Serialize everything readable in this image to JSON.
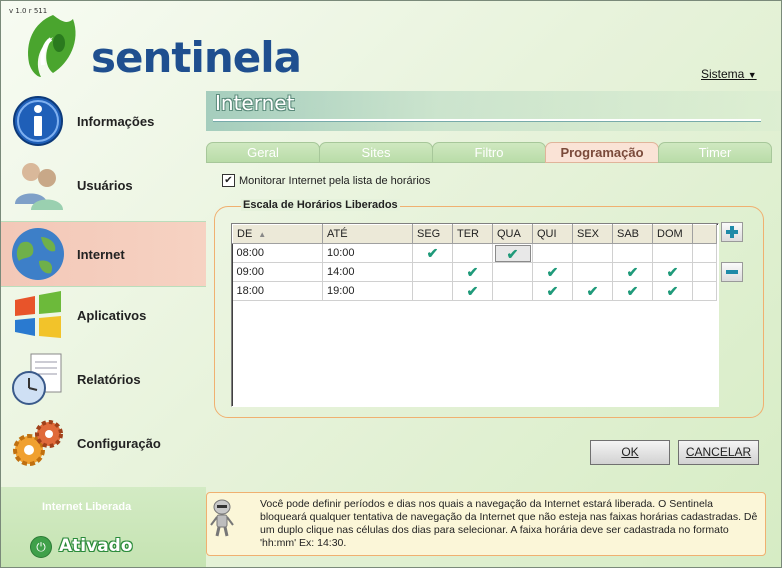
{
  "app": {
    "version": "v 1.0 r 511",
    "logo_text": "sentinela",
    "system_menu": "Sistema"
  },
  "sidebar": {
    "items": [
      {
        "label": "Informações",
        "icon": "info-icon"
      },
      {
        "label": "Usuários",
        "icon": "users-icon"
      },
      {
        "label": "Internet",
        "icon": "globe-icon",
        "active": true
      },
      {
        "label": "Aplicativos",
        "icon": "windows-icon"
      },
      {
        "label": "Relatórios",
        "icon": "report-clock-icon"
      },
      {
        "label": "Configuração",
        "icon": "gears-icon"
      }
    ],
    "status_label": "Internet Liberada",
    "status_value": "Ativado"
  },
  "main": {
    "section_title": "Internet",
    "tabs": [
      {
        "label": "Geral"
      },
      {
        "label": "Sites"
      },
      {
        "label": "Filtro"
      },
      {
        "label": "Programação",
        "active": true
      },
      {
        "label": "Timer"
      }
    ],
    "monitor_checkbox": {
      "label": "Monitorar Internet pela lista de horários",
      "checked": true
    },
    "group_title": "Escala de Horários Liberados",
    "table": {
      "columns": [
        "DE",
        "ATÉ",
        "SEG",
        "TER",
        "QUA",
        "QUI",
        "SEX",
        "SAB",
        "DOM"
      ],
      "rows": [
        {
          "de": "08:00",
          "ate": "10:00",
          "days": [
            true,
            false,
            true,
            false,
            false,
            false,
            false
          ]
        },
        {
          "de": "09:00",
          "ate": "14:00",
          "days": [
            false,
            true,
            false,
            true,
            false,
            true,
            true
          ]
        },
        {
          "de": "18:00",
          "ate": "19:00",
          "days": [
            false,
            true,
            false,
            true,
            true,
            true,
            true
          ]
        }
      ],
      "selected_cell": {
        "row": 0,
        "day": 2
      }
    },
    "buttons": {
      "ok": "OK",
      "cancel": "CANCELAR"
    },
    "info_text": "Você pode definir períodos e dias nos quais a navegação da Internet estará liberada. O Sentinela bloqueará qualquer tentativa de navegação da Internet que não esteja nas faixas horárias cadastradas. Dê um duplo clique nas células dos dias para selecionar. A faixa horária deve ser cadastrada no formato 'hh:mm' Ex: 14:30."
  },
  "colors": {
    "logo_blue": "#1f4f8f",
    "logo_green": "#4aa52e",
    "tick_green": "#1f9a7a",
    "active_nav": "#f3c8b8",
    "group_border": "#f0b070"
  }
}
